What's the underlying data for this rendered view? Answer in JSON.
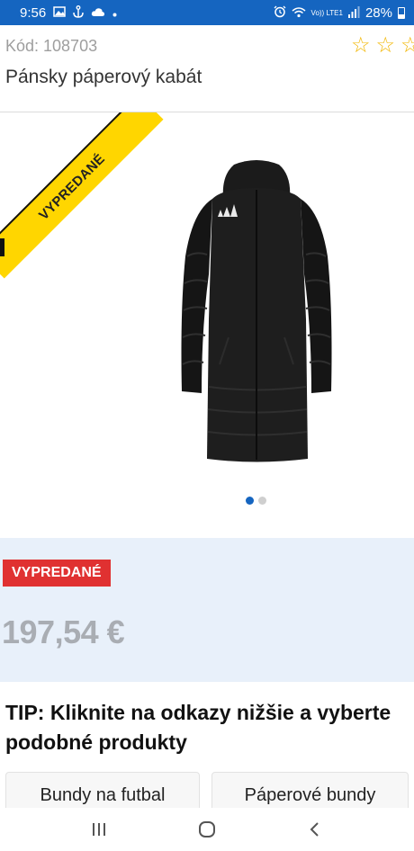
{
  "status_bar": {
    "time": "9:56",
    "carrier": "Vo)) LTE1",
    "battery": "28%"
  },
  "product": {
    "code": "Kód: 108703",
    "title": "Pánsky páperový kabát",
    "rating_stars": 0,
    "ribbon_label": "VYPREDANÉ",
    "image_index": 1,
    "image_count": 2
  },
  "price_block": {
    "badge": "VYPREDANÉ",
    "price": "197,54 €"
  },
  "tip": {
    "text": "TIP: Kliknite na odkazy nižšie a vyberte podobné produkty"
  },
  "related": [
    {
      "label": "Bundy na futbal"
    },
    {
      "label": "Páperové bundy"
    }
  ],
  "colors": {
    "status_bar": "#1565c0",
    "star": "#f2b705",
    "ribbon": "#ffd600",
    "badge": "#e03131",
    "price_block_bg": "#e8f0fa",
    "dot_active": "#1565c0"
  },
  "icons": {
    "status_left": [
      "image-icon",
      "anchor-icon",
      "cloud-icon",
      "dot-icon"
    ],
    "status_right": [
      "alarm-icon",
      "wifi-icon",
      "signal-icon",
      "battery-icon"
    ],
    "nav": [
      "recent-apps-icon",
      "home-icon",
      "back-icon"
    ]
  }
}
